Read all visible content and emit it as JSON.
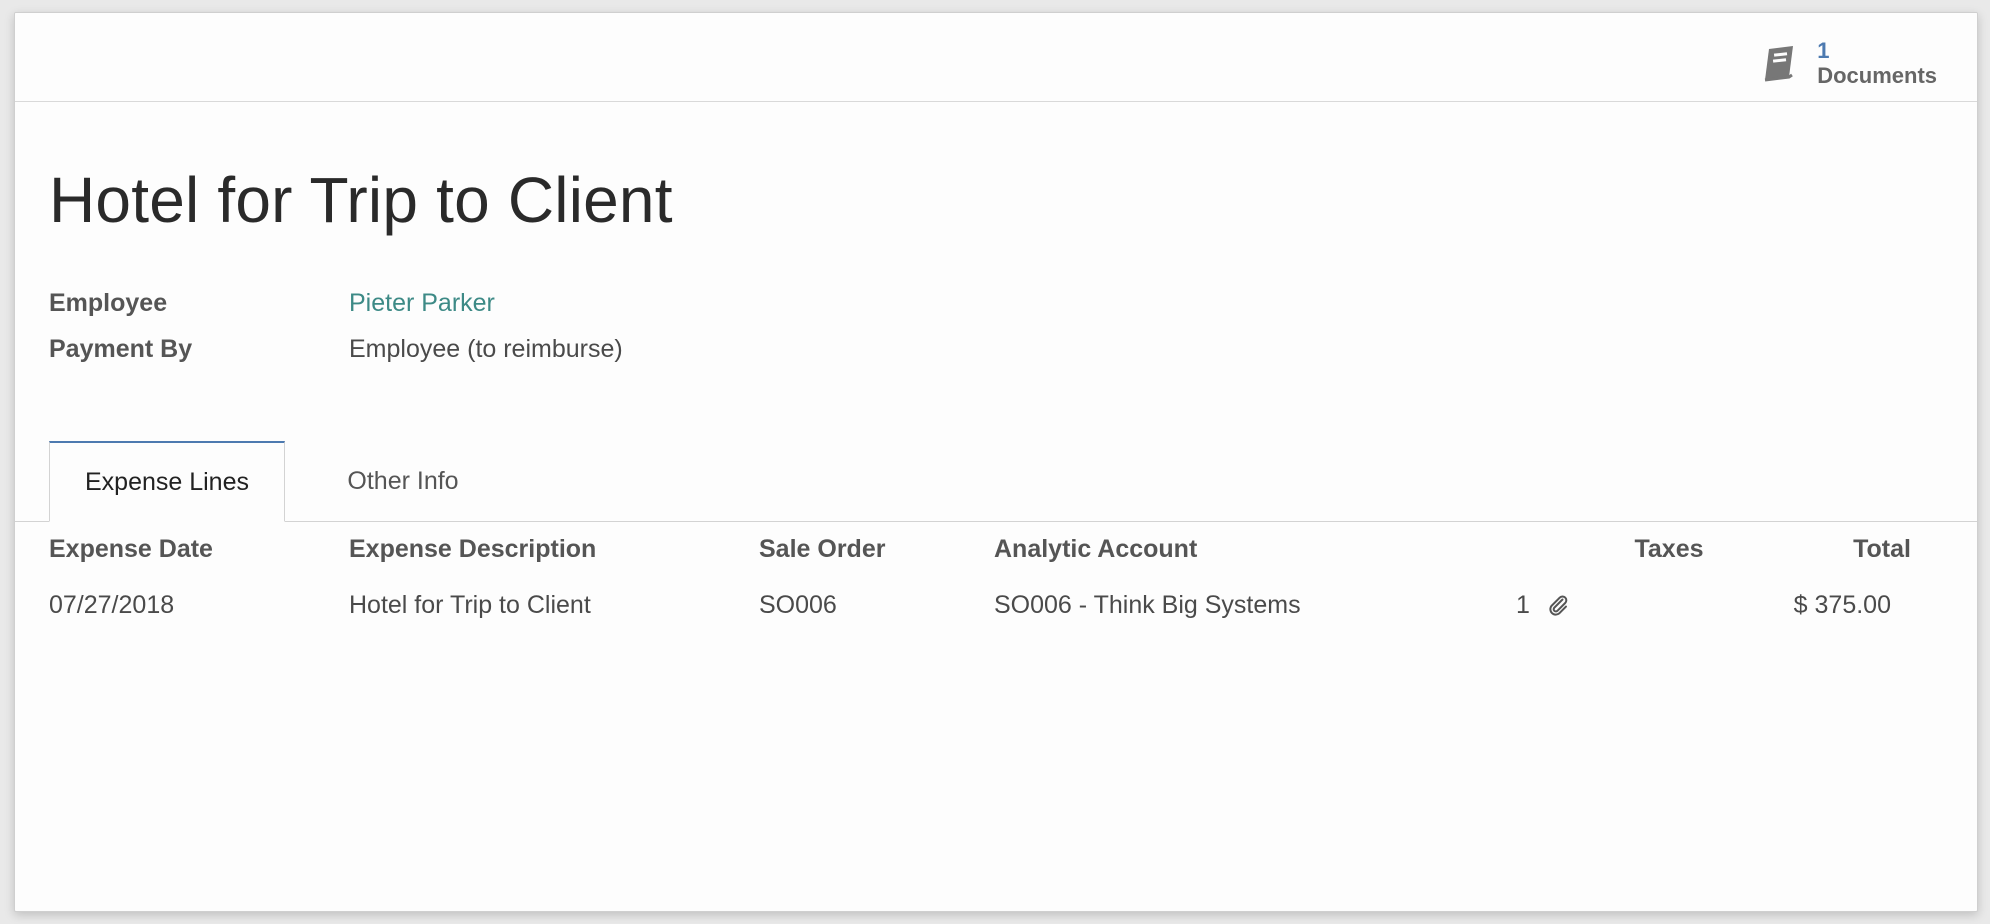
{
  "smart_button": {
    "count": "1",
    "label": "Documents",
    "icon": "book-icon"
  },
  "record": {
    "title": "Hotel for Trip to Client",
    "fields": [
      {
        "label": "Employee",
        "value": "Pieter Parker"
      },
      {
        "label": "Payment By",
        "value": "Employee (to reimburse)"
      }
    ]
  },
  "tabs": [
    {
      "label": "Expense Lines",
      "active": true
    },
    {
      "label": "Other Info",
      "active": false
    }
  ],
  "expense_lines": {
    "columns": [
      "Expense Date",
      "Expense Description",
      "Sale Order",
      "Analytic Account",
      "Taxes",
      "Total"
    ],
    "rows": [
      {
        "date": "07/27/2018",
        "description": "Hotel for Trip to Client",
        "sale_order": "SO006",
        "analytic_account": "SO006 - Think Big Systems",
        "attachments": "1",
        "attachment_icon": "paperclip-icon",
        "taxes": "",
        "total": "$ 375.00"
      }
    ]
  },
  "colors": {
    "accent": "#4d7ab0",
    "link": "#3d8a86"
  }
}
